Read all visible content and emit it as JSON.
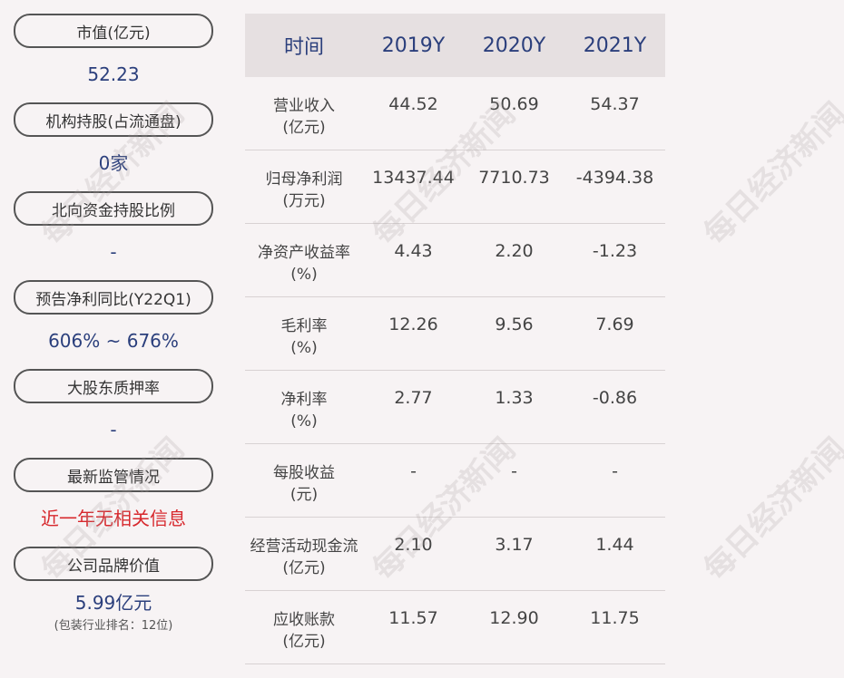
{
  "left_panel": {
    "items": [
      {
        "label": "市值(亿元)",
        "value": "52.23",
        "color": "#2b3f7c"
      },
      {
        "label": "机构持股(占流通盘)",
        "value": "0家",
        "color": "#2b3f7c"
      },
      {
        "label": "北向资金持股比例",
        "value": "-",
        "color": "#2b3f7c"
      },
      {
        "label": "预告净利同比(Y22Q1)",
        "value": "606% ~ 676%",
        "color": "#2b3f7c"
      },
      {
        "label": "大股东质押率",
        "value": "-",
        "color": "#2b3f7c"
      },
      {
        "label": "最新监管情况",
        "value": "近一年无相关信息",
        "color": "#d7282d"
      },
      {
        "label": "公司品牌价值",
        "value": "5.99亿元",
        "sub": "(包装行业排名：12位)",
        "color": "#2b3f7c"
      }
    ]
  },
  "table": {
    "header": {
      "col0": "时间",
      "years": [
        "2019Y",
        "2020Y",
        "2021Y"
      ]
    },
    "rows": [
      {
        "name": "营业收入",
        "unit": "(亿元)",
        "values": [
          "44.52",
          "50.69",
          "54.37"
        ]
      },
      {
        "name": "归母净利润",
        "unit": "(万元)",
        "values": [
          "13437.44",
          "7710.73",
          "-4394.38"
        ]
      },
      {
        "name": "净资产收益率",
        "unit": "(%)",
        "values": [
          "4.43",
          "2.20",
          "-1.23"
        ]
      },
      {
        "name": "毛利率",
        "unit": "(%)",
        "values": [
          "12.26",
          "9.56",
          "7.69"
        ]
      },
      {
        "name": "净利率",
        "unit": "(%)",
        "values": [
          "2.77",
          "1.33",
          "-0.86"
        ]
      },
      {
        "name": "每股收益",
        "unit": "(元)",
        "values": [
          "-",
          "-",
          "-"
        ]
      },
      {
        "name": "经营活动现金流",
        "unit": "(亿元)",
        "values": [
          "2.10",
          "3.17",
          "1.44"
        ]
      },
      {
        "name": "应收账款",
        "unit": "(亿元)",
        "values": [
          "11.57",
          "12.90",
          "11.75"
        ]
      }
    ]
  },
  "watermark": "每日经济新闻"
}
